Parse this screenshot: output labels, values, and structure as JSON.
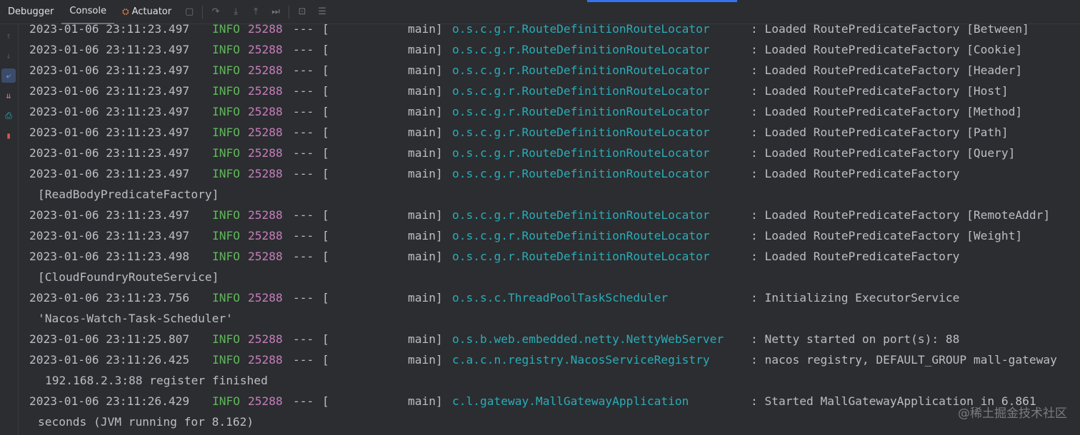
{
  "toolbar": {
    "tabs": [
      "Debugger",
      "Console",
      "Actuator"
    ],
    "active_tab": "Console",
    "accent_color": "#3574f0",
    "icons": [
      "stop-icon",
      "rerun-icon",
      "step-over-icon",
      "step-into-icon",
      "step-out-icon",
      "run-to-cursor-icon",
      "evaluate-icon",
      "more-icon"
    ]
  },
  "gutter": {
    "icons": [
      "scroll-up-icon",
      "scroll-down-icon",
      "soft-wrap-icon",
      "scroll-to-end-icon",
      "print-icon",
      "clear-all-icon"
    ]
  },
  "colors": {
    "info": "#5fb65a",
    "pid": "#c77dbb",
    "logger": "#2aacb8",
    "text": "#bcbec4",
    "background": "#2b2d30"
  },
  "log_lines": [
    {
      "ts": "2023-01-06 23:11:23.497",
      "level": "INFO",
      "pid": "25288",
      "sep": "---",
      "bracket": "[",
      "thread": "main]",
      "logger": "o.s.c.g.r.RouteDefinitionRouteLocator",
      "msg": ": Loaded RoutePredicateFactory [Between]"
    },
    {
      "ts": "2023-01-06 23:11:23.497",
      "level": "INFO",
      "pid": "25288",
      "sep": "---",
      "bracket": "[",
      "thread": "main]",
      "logger": "o.s.c.g.r.RouteDefinitionRouteLocator",
      "msg": ": Loaded RoutePredicateFactory [Cookie]"
    },
    {
      "ts": "2023-01-06 23:11:23.497",
      "level": "INFO",
      "pid": "25288",
      "sep": "---",
      "bracket": "[",
      "thread": "main]",
      "logger": "o.s.c.g.r.RouteDefinitionRouteLocator",
      "msg": ": Loaded RoutePredicateFactory [Header]"
    },
    {
      "ts": "2023-01-06 23:11:23.497",
      "level": "INFO",
      "pid": "25288",
      "sep": "---",
      "bracket": "[",
      "thread": "main]",
      "logger": "o.s.c.g.r.RouteDefinitionRouteLocator",
      "msg": ": Loaded RoutePredicateFactory [Host]"
    },
    {
      "ts": "2023-01-06 23:11:23.497",
      "level": "INFO",
      "pid": "25288",
      "sep": "---",
      "bracket": "[",
      "thread": "main]",
      "logger": "o.s.c.g.r.RouteDefinitionRouteLocator",
      "msg": ": Loaded RoutePredicateFactory [Method]"
    },
    {
      "ts": "2023-01-06 23:11:23.497",
      "level": "INFO",
      "pid": "25288",
      "sep": "---",
      "bracket": "[",
      "thread": "main]",
      "logger": "o.s.c.g.r.RouteDefinitionRouteLocator",
      "msg": ": Loaded RoutePredicateFactory [Path]"
    },
    {
      "ts": "2023-01-06 23:11:23.497",
      "level": "INFO",
      "pid": "25288",
      "sep": "---",
      "bracket": "[",
      "thread": "main]",
      "logger": "o.s.c.g.r.RouteDefinitionRouteLocator",
      "msg": ": Loaded RoutePredicateFactory [Query]"
    },
    {
      "ts": "2023-01-06 23:11:23.497",
      "level": "INFO",
      "pid": "25288",
      "sep": "---",
      "bracket": "[",
      "thread": "main]",
      "logger": "o.s.c.g.r.RouteDefinitionRouteLocator",
      "msg": ": Loaded RoutePredicateFactory"
    },
    {
      "cont": "[ReadBodyPredicateFactory]"
    },
    {
      "ts": "2023-01-06 23:11:23.497",
      "level": "INFO",
      "pid": "25288",
      "sep": "---",
      "bracket": "[",
      "thread": "main]",
      "logger": "o.s.c.g.r.RouteDefinitionRouteLocator",
      "msg": ": Loaded RoutePredicateFactory [RemoteAddr]"
    },
    {
      "ts": "2023-01-06 23:11:23.497",
      "level": "INFO",
      "pid": "25288",
      "sep": "---",
      "bracket": "[",
      "thread": "main]",
      "logger": "o.s.c.g.r.RouteDefinitionRouteLocator",
      "msg": ": Loaded RoutePredicateFactory [Weight]"
    },
    {
      "ts": "2023-01-06 23:11:23.498",
      "level": "INFO",
      "pid": "25288",
      "sep": "---",
      "bracket": "[",
      "thread": "main]",
      "logger": "o.s.c.g.r.RouteDefinitionRouteLocator",
      "msg": ": Loaded RoutePredicateFactory"
    },
    {
      "cont": "[CloudFoundryRouteService]"
    },
    {
      "ts": "2023-01-06 23:11:23.756",
      "level": "INFO",
      "pid": "25288",
      "sep": "---",
      "bracket": "[",
      "thread": "main]",
      "logger": "o.s.s.c.ThreadPoolTaskScheduler",
      "msg": ": Initializing ExecutorService"
    },
    {
      "cont": "'Nacos-Watch-Task-Scheduler'"
    },
    {
      "ts": "2023-01-06 23:11:25.807",
      "level": "INFO",
      "pid": "25288",
      "sep": "---",
      "bracket": "[",
      "thread": "main]",
      "logger": "o.s.b.web.embedded.netty.NettyWebServer",
      "msg": ": Netty started on port(s): 88"
    },
    {
      "ts": "2023-01-06 23:11:26.425",
      "level": "INFO",
      "pid": "25288",
      "sep": "---",
      "bracket": "[",
      "thread": "main]",
      "logger": "c.a.c.n.registry.NacosServiceRegistry",
      "msg": ": nacos registry, DEFAULT_GROUP mall-gateway"
    },
    {
      "cont": "192.168.2.3:88 register finished",
      "indent": true
    },
    {
      "ts": "2023-01-06 23:11:26.429",
      "level": "INFO",
      "pid": "25288",
      "sep": "---",
      "bracket": "[",
      "thread": "main]",
      "logger": "c.l.gateway.MallGatewayApplication",
      "msg": ": Started MallGatewayApplication in 6.861"
    },
    {
      "cont": "seconds (JVM running for 8.162)"
    }
  ],
  "watermark": "@稀土掘金技术社区"
}
